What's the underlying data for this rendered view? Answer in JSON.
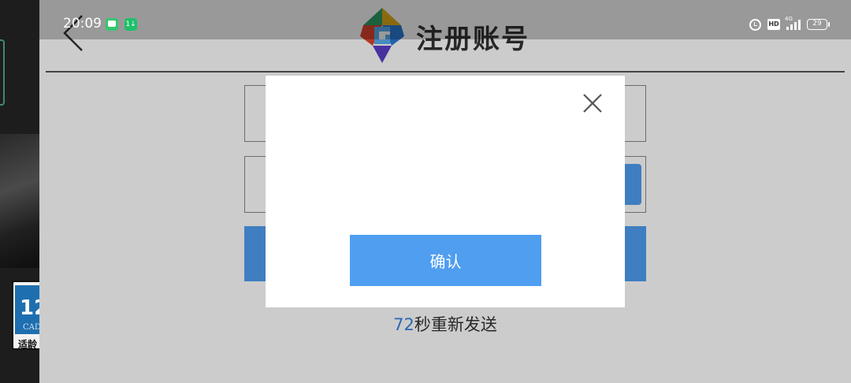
{
  "status_bar": {
    "time": "20:09",
    "notification_badge": "1↓",
    "hd_label": "HD",
    "network_label": "4G",
    "battery": "29"
  },
  "header": {
    "title": "注册账号"
  },
  "resend": {
    "seconds": "72",
    "suffix": "秒重新发送"
  },
  "dialog": {
    "confirm_label": "确认"
  },
  "age_badge": {
    "number": "12",
    "cad": "CAD",
    "text": "适龄"
  },
  "colors": {
    "accent": "#4f9ef0",
    "overlay": "rgba(0,0,0,0.2)"
  }
}
